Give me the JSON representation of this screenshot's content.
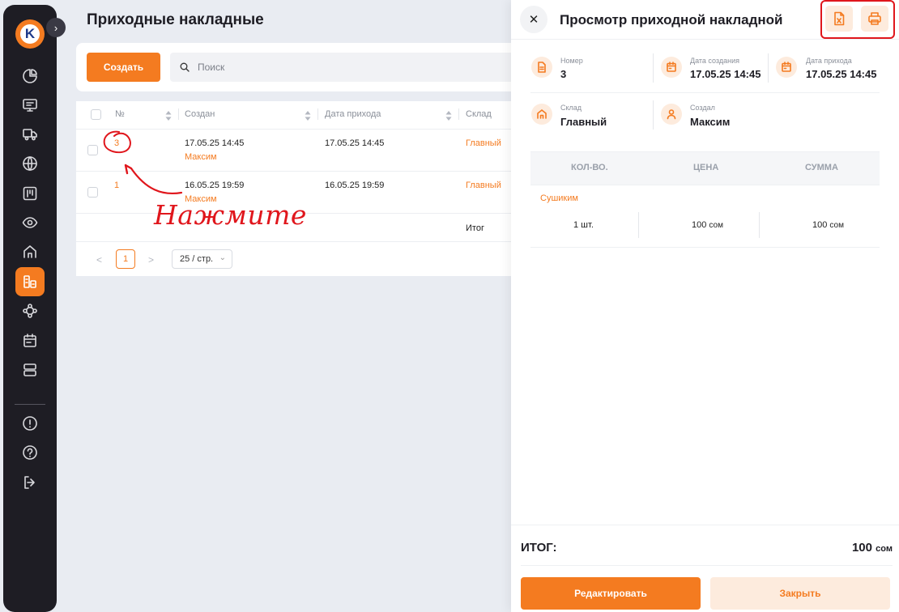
{
  "sidebar": {
    "logo_letter": "K",
    "expand_glyph": "›",
    "items": [
      {
        "name": "nav-dashboard",
        "icon": "pie-chart-icon"
      },
      {
        "name": "nav-pos",
        "icon": "monitor-icon"
      },
      {
        "name": "nav-delivery",
        "icon": "truck-icon"
      },
      {
        "name": "nav-online",
        "icon": "globe-icon"
      },
      {
        "name": "nav-board",
        "icon": "kanban-icon"
      },
      {
        "name": "nav-view",
        "icon": "eye-icon"
      },
      {
        "name": "nav-home",
        "icon": "home-icon"
      },
      {
        "name": "nav-warehouse",
        "icon": "warehouse-icon",
        "active": true
      },
      {
        "name": "nav-integrations",
        "icon": "nodes-icon"
      },
      {
        "name": "nav-calendar",
        "icon": "calendar-icon"
      },
      {
        "name": "nav-storage",
        "icon": "server-icon"
      },
      {
        "name": "nav-alerts",
        "icon": "alert-circle-icon"
      },
      {
        "name": "nav-help",
        "icon": "help-circle-icon"
      },
      {
        "name": "nav-logout",
        "icon": "logout-icon"
      }
    ]
  },
  "main": {
    "title": "Приходные накладные",
    "create_label": "Создать",
    "search_placeholder": "Поиск",
    "table": {
      "headers": {
        "num": "№",
        "created": "Создан",
        "arrival": "Дата прихода",
        "warehouse": "Склад"
      },
      "rows": [
        {
          "num": "3",
          "created": "17.05.25 14:45",
          "author": "Максим",
          "arrival": "17.05.25 14:45",
          "warehouse": "Главный"
        },
        {
          "num": "1",
          "created": "16.05.25 19:59",
          "author": "Максим",
          "arrival": "16.05.25 19:59",
          "warehouse": "Главный"
        }
      ],
      "total_label": "Итог"
    },
    "pagination": {
      "prev": "<",
      "current": "1",
      "next": ">",
      "page_size": "25 / стр."
    }
  },
  "annotation": {
    "text": "Нажмите",
    "color": "#e0161c"
  },
  "drawer": {
    "title": "Просмотр приходной накладной",
    "close_glyph": "✕",
    "fields": {
      "number_label": "Номер",
      "number_value": "3",
      "created_label": "Дата создания",
      "created_value": "17.05.25 14:45",
      "arrival_label": "Дата прихода",
      "arrival_value": "17.05.25 14:45",
      "warehouse_label": "Склад",
      "warehouse_value": "Главный",
      "author_label": "Создал",
      "author_value": "Максим"
    },
    "items_table": {
      "headers": {
        "qty": "КОЛ-ВО.",
        "price": "ЦЕНА",
        "sum": "СУММА"
      },
      "items": [
        {
          "name": "Сушиким",
          "qty": "1 шт.",
          "price": "100",
          "price_unit": "сом",
          "sum": "100",
          "sum_unit": "сом"
        }
      ]
    },
    "total_label": "ИТОГ:",
    "total_value": "100",
    "total_unit": "сом",
    "edit_label": "Редактировать",
    "close_label": "Закрыть"
  },
  "colors": {
    "accent": "#f47b20",
    "accent_light": "#fdebdd",
    "sidebar_bg": "#1e1d24",
    "annotation": "#e0161c"
  }
}
